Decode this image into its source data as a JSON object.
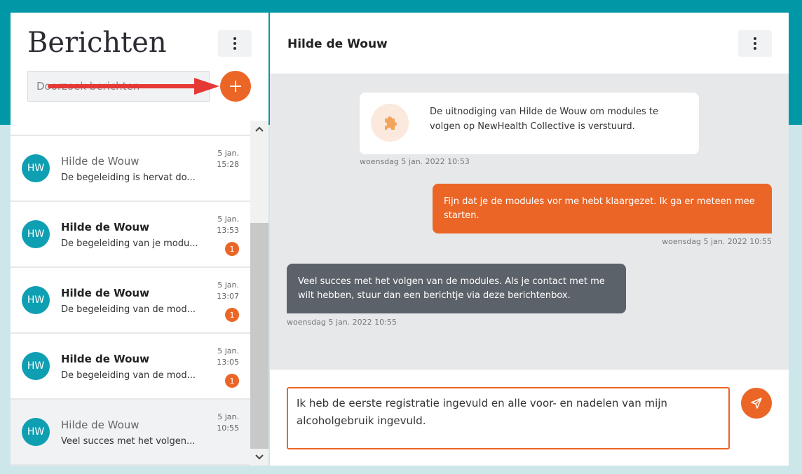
{
  "sidebar": {
    "title": "Berichten",
    "search_placeholder": "Doorzoek berichten",
    "conversations": [
      {
        "initials": "HW",
        "name": "Hilde de Wouw",
        "preview": "De begeleiding is hervat do...",
        "date": "5 jan.",
        "time": "15:28",
        "unread": "",
        "bold": false,
        "active": false
      },
      {
        "initials": "HW",
        "name": "Hilde de Wouw",
        "preview": "De begeleiding van je modu...",
        "date": "5 jan.",
        "time": "13:53",
        "unread": "1",
        "bold": true,
        "active": false
      },
      {
        "initials": "HW",
        "name": "Hilde de Wouw",
        "preview": "De begeleiding van de mod...",
        "date": "5 jan.",
        "time": "13:07",
        "unread": "1",
        "bold": true,
        "active": false
      },
      {
        "initials": "HW",
        "name": "Hilde de Wouw",
        "preview": "De begeleiding van de mod...",
        "date": "5 jan.",
        "time": "13:05",
        "unread": "1",
        "bold": true,
        "active": false
      },
      {
        "initials": "HW",
        "name": "Hilde de Wouw",
        "preview": "Veel succes met het volgen...",
        "date": "5 jan.",
        "time": "10:55",
        "unread": "",
        "bold": false,
        "active": true
      }
    ]
  },
  "conversation": {
    "title": "Hilde de Wouw",
    "system_message": {
      "text": "De uitnodiging van Hilde de Wouw om modules te volgen op NewHealth Collective is verstuurd.",
      "timestamp": "woensdag 5 jan. 2022 10:53",
      "icon": "puzzle-icon"
    },
    "messages": [
      {
        "direction": "out",
        "text": "Fijn dat je de modules vor me hebt klaargezet. Ik ga er meteen mee starten.",
        "timestamp": "woensdag 5 jan. 2022 10:55"
      },
      {
        "direction": "in",
        "text": "Veel succes met het volgen van de modules. Als je contact met me wilt hebben, stuur dan een berichtje via deze berichtenbox.",
        "timestamp": "woensdag 5 jan. 2022 10:55"
      }
    ],
    "draft": "Ik heb de eerste registratie ingevuld en alle voor- en nadelen van mijn alcoholgebruik ingevuld."
  },
  "colors": {
    "accent": "#eb6626",
    "header_band": "#0097a7",
    "avatar": "#0f9fb3",
    "incoming_bubble": "#5c6269"
  }
}
